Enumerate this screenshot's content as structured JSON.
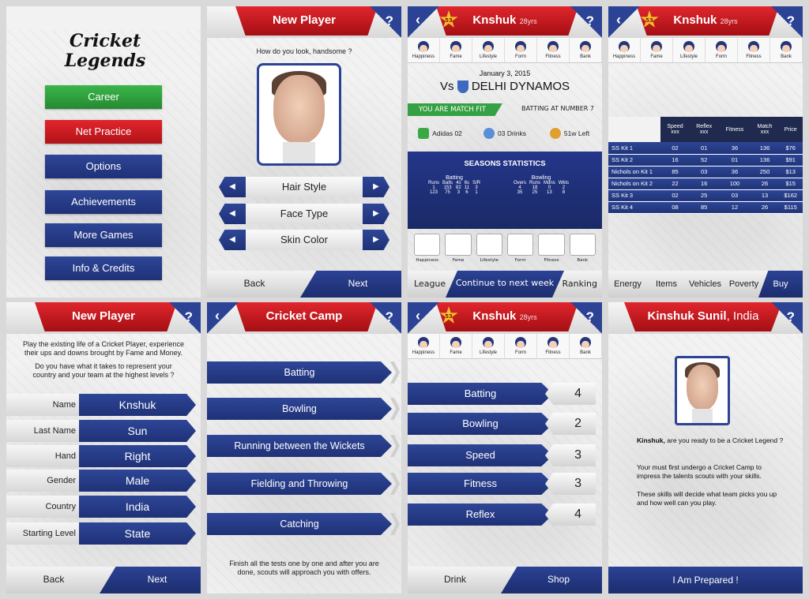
{
  "s1": {
    "logo_line1": "Cricket",
    "logo_line2": "Legends",
    "menu": [
      {
        "label": "Career",
        "color": "#2fa33e"
      },
      {
        "label": "Net Practice",
        "color": "#cf1d24"
      },
      {
        "label": "Options",
        "color": "#263c8a"
      },
      {
        "label": "Achievements",
        "color": "#263c8a"
      },
      {
        "label": "More Games",
        "color": "#263c8a"
      },
      {
        "label": "Info & Credits",
        "color": "#263c8a"
      }
    ]
  },
  "s2": {
    "title": "New Player",
    "help": "?",
    "question": "How do you look, handsome ?",
    "selectors": [
      "Hair Style",
      "Face Type",
      "Skin Color"
    ],
    "back": "Back",
    "next": "Next"
  },
  "s3": {
    "name": "Knshuk",
    "age": "28yrs",
    "level": "53",
    "help": "?",
    "stats": [
      "Happiness",
      "Fame",
      "Lifestyle",
      "Form",
      "Fitness",
      "Bank"
    ],
    "date": "January 3, 2015",
    "vs": "Vs",
    "opponent": "DELHI DYNAMOS",
    "fit": "YOU ARE MATCH FIT",
    "batting": "BATTING AT NUMBER 7",
    "inventory": [
      "Adidas 02",
      "03 Drinks",
      "51w Left"
    ],
    "seasons_title": "SEASONS STATISTICS",
    "batting_label": "Batting",
    "bowling_label": "Bowling",
    "bat_cols": [
      "Runs",
      "Balls",
      "4s",
      "6s",
      "S/R"
    ],
    "bat_rows": [
      [
        "1",
        "153",
        "82",
        "11",
        "3"
      ],
      [
        "123",
        "75",
        "3",
        "6",
        "1"
      ]
    ],
    "bowl_cols": [
      "Overs",
      "Runs",
      "Mdns",
      "Wkts"
    ],
    "bowl_rows": [
      [
        "4",
        "18",
        "0",
        "2"
      ],
      [
        "35",
        "25",
        "13",
        "8"
      ]
    ],
    "slots": [
      "Happiness",
      "Fame",
      "Lifestyle",
      "Form",
      "Fitness",
      "Bank"
    ],
    "nav": [
      "League",
      "Continue to next week",
      "Ranking"
    ]
  },
  "s4": {
    "name": "Knshuk",
    "age": "28yrs",
    "level": "53",
    "help": "?",
    "stats": [
      "Happiness",
      "Fame",
      "Lifestyle",
      "Form",
      "Fitness",
      "Bank"
    ],
    "cols": [
      "Speed",
      "Reflex",
      "Fitness",
      "Match",
      "Price"
    ],
    "col_subs": [
      "xxx",
      "xxx",
      "",
      "xxx",
      ""
    ],
    "rows": [
      [
        "SS Kit 1",
        "02",
        "01",
        "36",
        "136",
        "$76"
      ],
      [
        "SS Kit 2",
        "16",
        "52",
        "01",
        "136",
        "$91"
      ],
      [
        "Nichols on Kit 1",
        "85",
        "03",
        "36",
        "250",
        "$13"
      ],
      [
        "Nichols on Kit 2",
        "22",
        "16",
        "100",
        "26",
        "$15"
      ],
      [
        "SS Kit 3",
        "02",
        "25",
        "03",
        "13",
        "$162"
      ],
      [
        "SS Kit 4",
        "08",
        "85",
        "12",
        "26",
        "$115"
      ]
    ],
    "nav": [
      "Energy",
      "Items",
      "Vehicles",
      "Poverty"
    ],
    "buy": "Buy"
  },
  "s5": {
    "title": "New Player",
    "help": "?",
    "intro1": "Play the existing life of a Cricket Player, experience",
    "intro2": "their ups and downs brought by Fame and Money.",
    "intro3": "Do you have what it takes to represent your",
    "intro4": "country and your team at the highest levels ?",
    "fields": [
      {
        "label": "Name",
        "value": "Knshuk"
      },
      {
        "label": "Last Name",
        "value": "Sun"
      },
      {
        "label": "Hand",
        "value": "Right"
      },
      {
        "label": "Gender",
        "value": "Male"
      },
      {
        "label": "Country",
        "value": "India"
      },
      {
        "label": "Starting Level",
        "value": "State"
      }
    ],
    "back": "Back",
    "next": "Next"
  },
  "s6": {
    "title": "Cricket Camp",
    "help": "?",
    "items": [
      "Batting",
      "Bowling",
      "Running between the Wickets",
      "Fielding and Throwing",
      "Catching"
    ],
    "foot1": "Finish all the tests one by one and after you are",
    "foot2": "done, scouts will approach you with offers."
  },
  "s7": {
    "name": "Knshuk",
    "age": "28yrs",
    "level": "53",
    "help": "?",
    "stats": [
      "Happiness",
      "Fame",
      "Lifestyle",
      "Form",
      "Fitness",
      "Bank"
    ],
    "skills": [
      {
        "label": "Batting",
        "value": "4"
      },
      {
        "label": "Bowling",
        "value": "2"
      },
      {
        "label": "Speed",
        "value": "3"
      },
      {
        "label": "Fitness",
        "value": "3"
      },
      {
        "label": "Reflex",
        "value": "4"
      }
    ],
    "drink": "Drink",
    "shop": "Shop"
  },
  "s8": {
    "name": "Kinshuk Sunil",
    "country": ", India",
    "help": "?",
    "name_short": "Kinshuk,",
    "p1": " are you ready to be a Cricket Legend ?",
    "p2": "Your must first undergo a Cricket Camp to impress the talents scouts with your skills.",
    "p3": "These skills will decide what team picks you up and how well can you play.",
    "cta": "I Am Prepared !"
  }
}
